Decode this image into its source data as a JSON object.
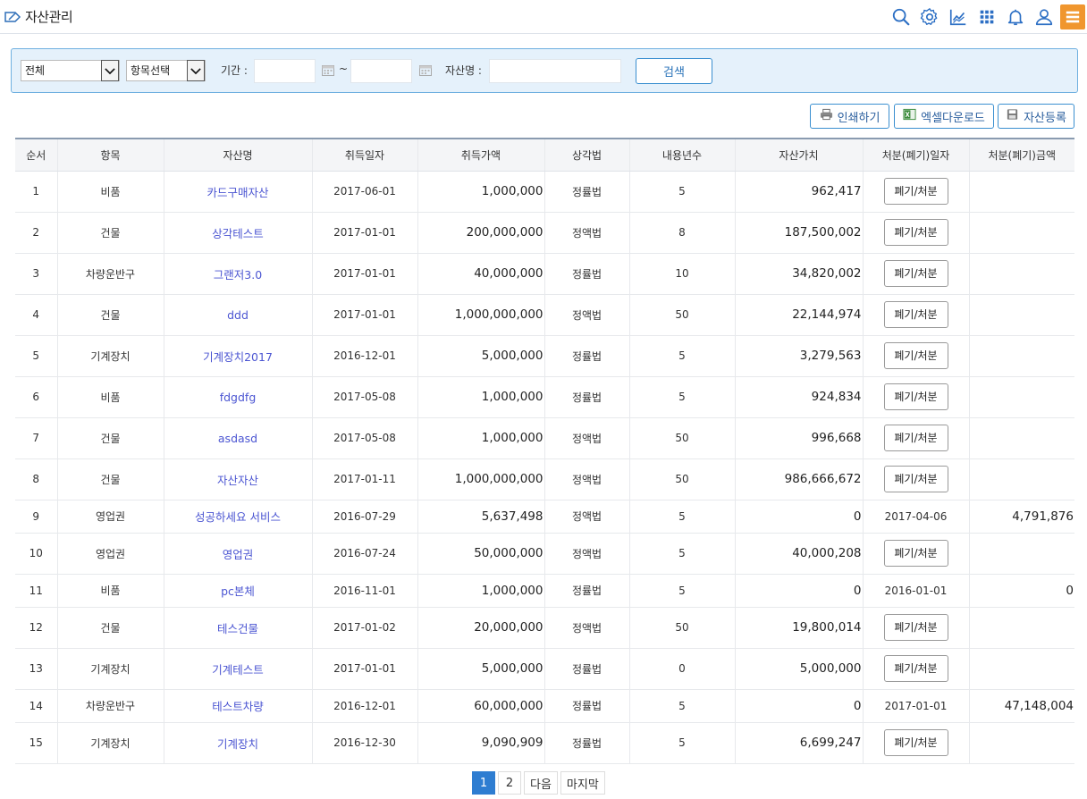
{
  "header": {
    "title": "자산관리",
    "icons": [
      "search-icon",
      "gear-icon",
      "chart-icon",
      "grid-icon",
      "bell-icon",
      "user-icon",
      "menu-icon"
    ],
    "accent_color": "#f0962e"
  },
  "search": {
    "category_select": "전체",
    "item_select": "항목선택",
    "period_label": "기간 :",
    "date_from": "",
    "date_to": "",
    "range_separator": "~",
    "asset_name_label": "자산명 :",
    "asset_name_value": "",
    "search_button": "검색"
  },
  "actions": {
    "print_label": "인쇄하기",
    "excel_label": "엑셀다운로드",
    "register_label": "자산등록"
  },
  "table": {
    "columns": [
      "순서",
      "항목",
      "자산명",
      "취득일자",
      "취득가액",
      "상각법",
      "내용년수",
      "자산가치",
      "처분(폐기)일자",
      "처분(폐기)금액"
    ],
    "dispose_button": "폐기/처분",
    "rows": [
      {
        "no": "1",
        "item": "비품",
        "name": "카드구매자산",
        "acq_date": "2017-06-01",
        "acq_price": "1,000,000",
        "method": "정률법",
        "years": "5",
        "value": "962,417",
        "disp_date": "",
        "disp_amount": ""
      },
      {
        "no": "2",
        "item": "건물",
        "name": "상각테스트",
        "acq_date": "2017-01-01",
        "acq_price": "200,000,000",
        "method": "정액법",
        "years": "8",
        "value": "187,500,002",
        "disp_date": "",
        "disp_amount": ""
      },
      {
        "no": "3",
        "item": "차량운반구",
        "name": "그랜저3.0",
        "acq_date": "2017-01-01",
        "acq_price": "40,000,000",
        "method": "정률법",
        "years": "10",
        "value": "34,820,002",
        "disp_date": "",
        "disp_amount": ""
      },
      {
        "no": "4",
        "item": "건물",
        "name": "ddd",
        "acq_date": "2017-01-01",
        "acq_price": "1,000,000,000",
        "method": "정액법",
        "years": "50",
        "value": "22,144,974",
        "disp_date": "",
        "disp_amount": ""
      },
      {
        "no": "5",
        "item": "기계장치",
        "name": "기계장치2017",
        "acq_date": "2016-12-01",
        "acq_price": "5,000,000",
        "method": "정률법",
        "years": "5",
        "value": "3,279,563",
        "disp_date": "",
        "disp_amount": ""
      },
      {
        "no": "6",
        "item": "비품",
        "name": "fdgdfg",
        "acq_date": "2017-05-08",
        "acq_price": "1,000,000",
        "method": "정률법",
        "years": "5",
        "value": "924,834",
        "disp_date": "",
        "disp_amount": ""
      },
      {
        "no": "7",
        "item": "건물",
        "name": "asdasd",
        "acq_date": "2017-05-08",
        "acq_price": "1,000,000",
        "method": "정액법",
        "years": "50",
        "value": "996,668",
        "disp_date": "",
        "disp_amount": ""
      },
      {
        "no": "8",
        "item": "건물",
        "name": "자산자산",
        "acq_date": "2017-01-11",
        "acq_price": "1,000,000,000",
        "method": "정액법",
        "years": "50",
        "value": "986,666,672",
        "disp_date": "",
        "disp_amount": ""
      },
      {
        "no": "9",
        "item": "영업권",
        "name": "성공하세요 서비스",
        "acq_date": "2016-07-29",
        "acq_price": "5,637,498",
        "method": "정액법",
        "years": "5",
        "value": "0",
        "disp_date": "2017-04-06",
        "disp_amount": "4,791,876"
      },
      {
        "no": "10",
        "item": "영업권",
        "name": "영업권",
        "acq_date": "2016-07-24",
        "acq_price": "50,000,000",
        "method": "정액법",
        "years": "5",
        "value": "40,000,208",
        "disp_date": "",
        "disp_amount": ""
      },
      {
        "no": "11",
        "item": "비품",
        "name": "pc본체",
        "acq_date": "2016-11-01",
        "acq_price": "1,000,000",
        "method": "정률법",
        "years": "5",
        "value": "0",
        "disp_date": "2016-01-01",
        "disp_amount": "0"
      },
      {
        "no": "12",
        "item": "건물",
        "name": "테스건물",
        "acq_date": "2017-01-02",
        "acq_price": "20,000,000",
        "method": "정액법",
        "years": "50",
        "value": "19,800,014",
        "disp_date": "",
        "disp_amount": ""
      },
      {
        "no": "13",
        "item": "기계장치",
        "name": "기계테스트",
        "acq_date": "2017-01-01",
        "acq_price": "5,000,000",
        "method": "정률법",
        "years": "0",
        "value": "5,000,000",
        "disp_date": "",
        "disp_amount": ""
      },
      {
        "no": "14",
        "item": "차량운반구",
        "name": "테스트차량",
        "acq_date": "2016-12-01",
        "acq_price": "60,000,000",
        "method": "정률법",
        "years": "5",
        "value": "0",
        "disp_date": "2017-01-01",
        "disp_amount": "47,148,004"
      },
      {
        "no": "15",
        "item": "기계장치",
        "name": "기계장치",
        "acq_date": "2016-12-30",
        "acq_price": "9,090,909",
        "method": "정률법",
        "years": "5",
        "value": "6,699,247",
        "disp_date": "",
        "disp_amount": ""
      }
    ]
  },
  "pagination": {
    "pages": [
      "1",
      "2"
    ],
    "current": "1",
    "next_label": "다음",
    "last_label": "마지막"
  }
}
